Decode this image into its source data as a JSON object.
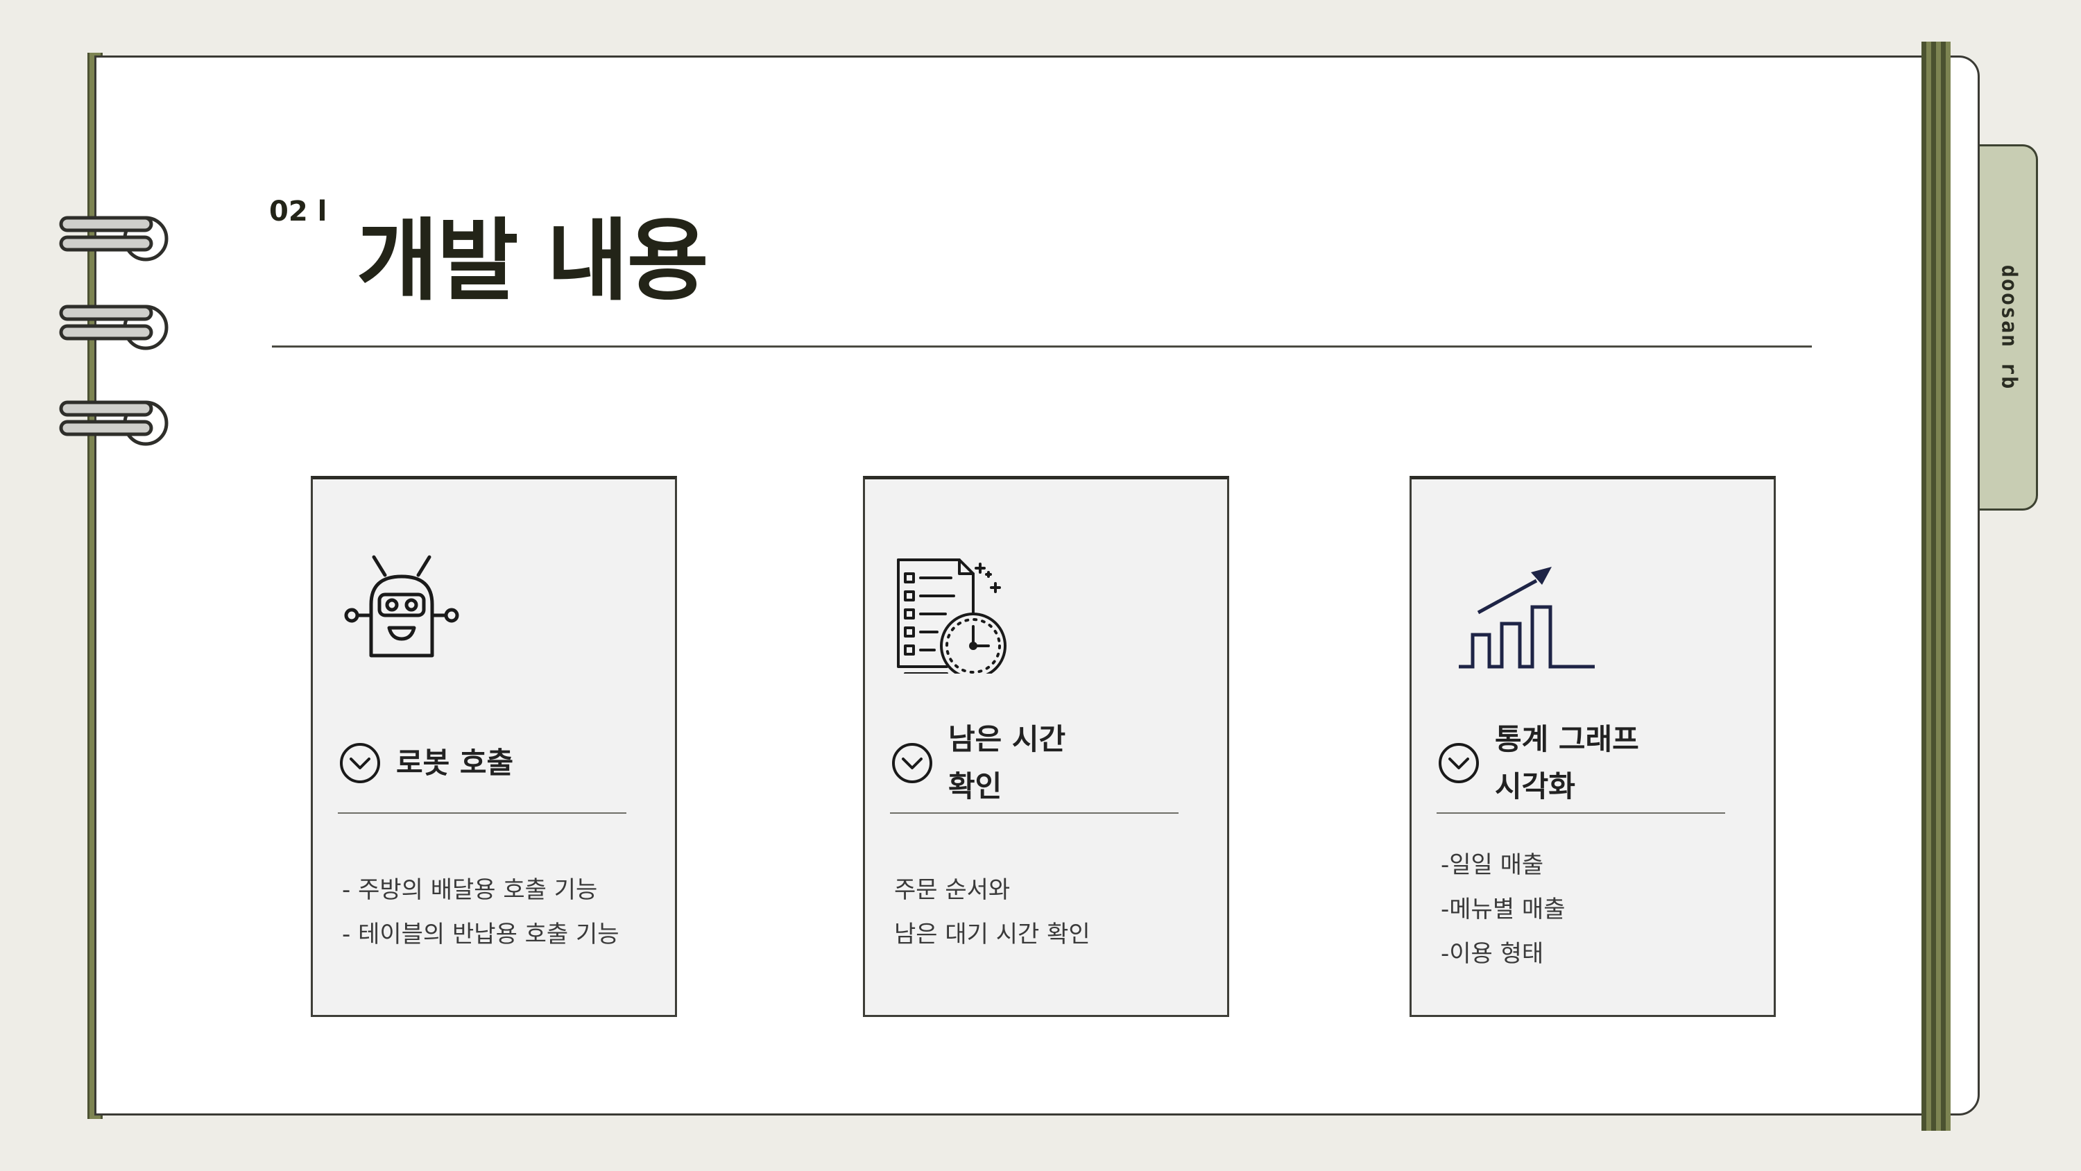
{
  "header": {
    "section_number": "02 l",
    "title": "개발 내용"
  },
  "tab": {
    "label": "doosan rb"
  },
  "cards": [
    {
      "icon": "robot-icon",
      "heading_lines": [
        "로봇 호출"
      ],
      "body_lines": [
        "- 주방의 배달용 호출 기능",
        "- 테이블의 반납용 호출 기능"
      ]
    },
    {
      "icon": "checklist-clock-icon",
      "heading_lines": [
        "남은 시간",
        "확인"
      ],
      "body_lines": [
        "주문 순서와",
        "남은 대기 시간 확인"
      ]
    },
    {
      "icon": "bar-chart-growth-icon",
      "heading_lines": [
        "통계 그래프",
        "시각화"
      ],
      "body_lines": [
        "-일일 매출",
        "-메뉴별 매출",
        "-이용 형태"
      ]
    }
  ],
  "colors": {
    "background": "#eeede7",
    "spine": "#7d8452",
    "tab": "#c8cdb3",
    "chart_icon": "#1e2446"
  }
}
